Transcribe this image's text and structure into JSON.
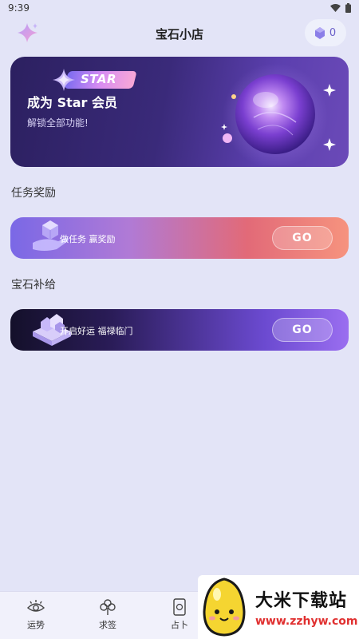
{
  "status_bar": {
    "time": "9:39"
  },
  "header": {
    "title": "宝石小店",
    "gem_count": "0"
  },
  "banner": {
    "badge": "STAR",
    "title": "成为 Star 会员",
    "subtitle": "解锁全部功能!"
  },
  "sections": [
    {
      "title": "任务奖励",
      "card_text": "做任务 赢奖励",
      "button": "GO"
    },
    {
      "title": "宝石补给",
      "card_text": "开启好运 福禄临门",
      "button": "GO"
    }
  ],
  "bottom_nav": [
    {
      "label": "运势",
      "icon": "eye-icon"
    },
    {
      "label": "求签",
      "icon": "clover-icon"
    },
    {
      "label": "占卜",
      "icon": "tarot-card-icon"
    }
  ],
  "watermark": {
    "title": "大米下载站",
    "url": "www.zzhyw.com"
  },
  "colors": {
    "background": "#e3e4f7",
    "accent": "#7a68e6",
    "banner": "#2c2060",
    "watermark_url": "#e03030"
  }
}
